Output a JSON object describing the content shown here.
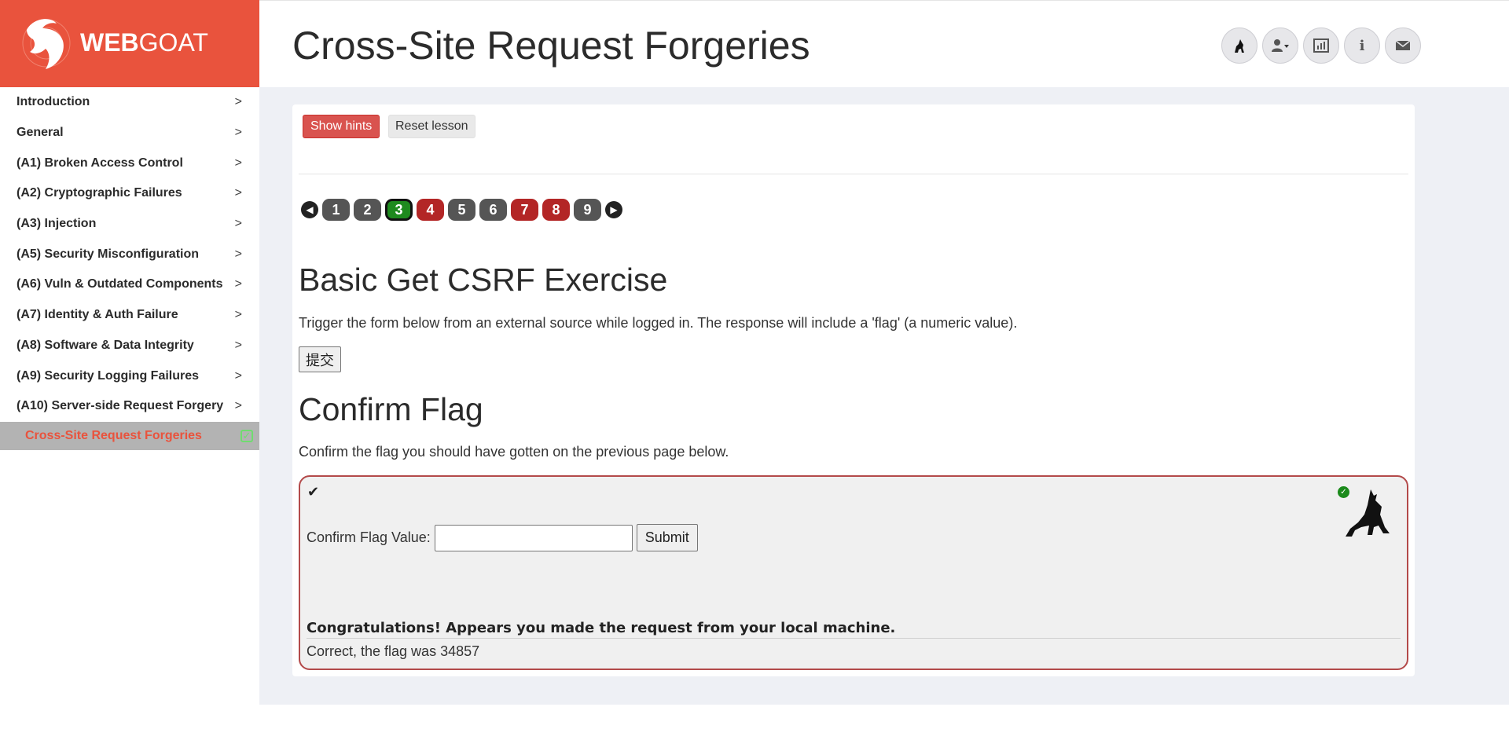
{
  "brand": {
    "name_bold": "WEB",
    "name_light": "GOAT"
  },
  "header": {
    "title": "Cross-Site Request Forgeries",
    "icons": [
      "wolf-icon",
      "user-icon",
      "chart-icon",
      "info-icon",
      "envelope-icon"
    ]
  },
  "sidebar": {
    "items": [
      {
        "label": "Introduction"
      },
      {
        "label": "General"
      },
      {
        "label": "(A1) Broken Access Control"
      },
      {
        "label": "(A2) Cryptographic Failures"
      },
      {
        "label": "(A3) Injection"
      },
      {
        "label": "(A5) Security Misconfiguration"
      },
      {
        "label": "(A6) Vuln & Outdated Components"
      },
      {
        "label": "(A7) Identity & Auth Failure"
      },
      {
        "label": "(A8) Software & Data Integrity"
      },
      {
        "label": "(A9) Security Logging Failures"
      },
      {
        "label": "(A10) Server-side Request Forgery"
      }
    ],
    "active_sub": "Cross-Site Request Forgeries",
    "chevron": ">"
  },
  "toolbar": {
    "hints_label": "Show hints",
    "reset_label": "Reset lesson"
  },
  "pager": {
    "pages": [
      {
        "num": "1",
        "state": "grey"
      },
      {
        "num": "2",
        "state": "grey"
      },
      {
        "num": "3",
        "state": "current"
      },
      {
        "num": "4",
        "state": "red"
      },
      {
        "num": "5",
        "state": "grey"
      },
      {
        "num": "6",
        "state": "grey"
      },
      {
        "num": "7",
        "state": "red"
      },
      {
        "num": "8",
        "state": "red"
      },
      {
        "num": "9",
        "state": "grey"
      }
    ]
  },
  "lesson": {
    "exercise_title": "Basic Get CSRF Exercise",
    "exercise_desc": "Trigger the form below from an external source while logged in. The response will include a 'flag' (a numeric value).",
    "submit_cn": "提交",
    "confirm_title": "Confirm Flag",
    "confirm_desc": "Confirm the flag you should have gotten on the previous page below.",
    "flag_label": "Confirm Flag Value:",
    "flag_value": "",
    "flag_submit": "Submit",
    "congrats": "Congratulations! Appears you made the request from your local machine.",
    "result": "Correct, the flag was 34857"
  },
  "colors": {
    "brand": "#e9533d",
    "success": "#1e8a1e",
    "failed": "#b32626"
  }
}
